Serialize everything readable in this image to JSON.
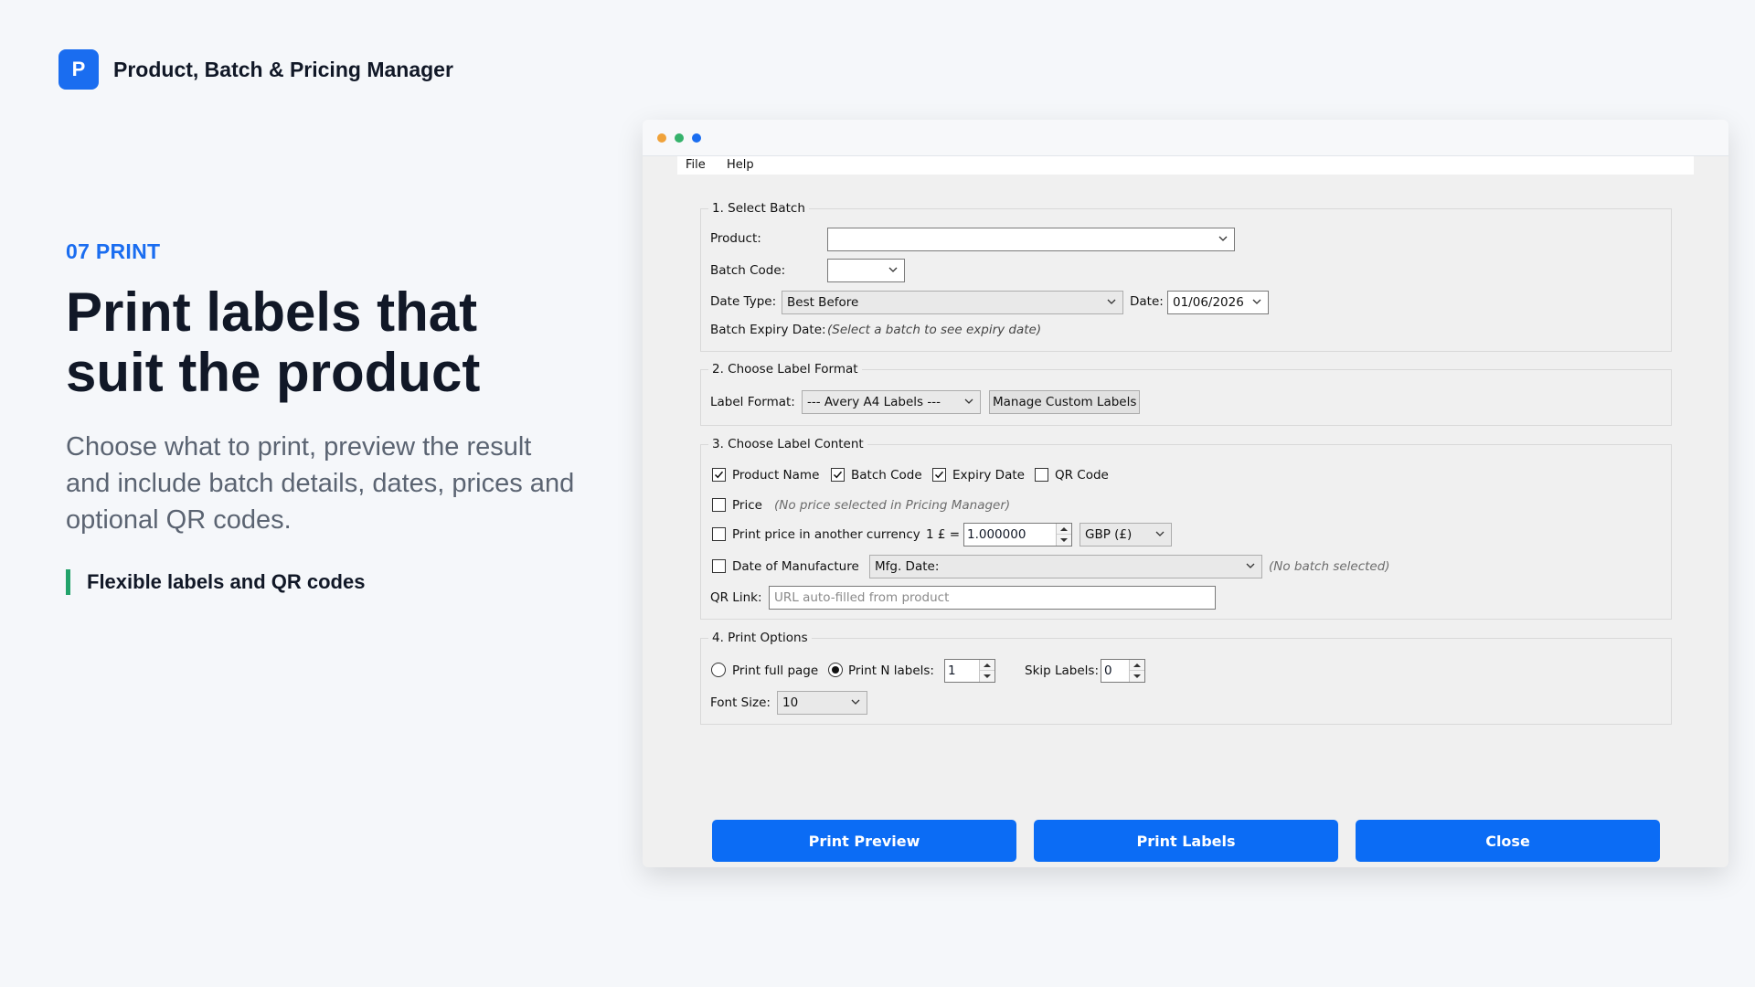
{
  "brand": {
    "badge": "P",
    "name": "Product, Batch & Pricing Manager",
    "color": "#1a6df0"
  },
  "hero": {
    "kicker": "07 PRINT",
    "headline": "Print labels that suit the product",
    "subtext": "Choose what to print, preview the result and include batch details, dates, prices and optional QR codes.",
    "feature": "Flexible labels and QR codes"
  },
  "window": {
    "traffic_colors": [
      "#f0a23a",
      "#35b26b",
      "#1a6df0"
    ],
    "menu": [
      "File",
      "Help"
    ],
    "select_batch": {
      "title": "1. Select Batch",
      "product_label": "Product:",
      "product_value": "",
      "batch_code_label": "Batch Code:",
      "batch_code_value": "",
      "date_type_label": "Date Type:",
      "date_type_value": "Best Before",
      "date_label": "Date:",
      "date_value": "01/06/2026",
      "expiry_label": "Batch Expiry Date:",
      "expiry_value": "(Select a batch to see expiry date)"
    },
    "label_format": {
      "title": "2. Choose Label Format",
      "label": "Label Format:",
      "value": "--- Avery A4 Labels ---",
      "manage_button": "Manage Custom Labels"
    },
    "label_content": {
      "title": "3. Choose Label Content",
      "product_name": {
        "label": "Product Name",
        "checked": true
      },
      "batch_code": {
        "label": "Batch Code",
        "checked": true
      },
      "expiry_date": {
        "label": "Expiry Date",
        "checked": true
      },
      "qr_code": {
        "label": "QR Code",
        "checked": false
      },
      "price": {
        "label": "Price",
        "checked": false,
        "note": "(No price selected in Pricing Manager)"
      },
      "currency": {
        "label": "Print price in another currency",
        "checked": false,
        "rate_label": "1 £ =",
        "rate_value": "1.000000",
        "currency_value": "GBP (£)"
      },
      "manufacture": {
        "label": "Date of Manufacture",
        "checked": false,
        "value": "Mfg. Date:",
        "note": "(No batch selected)"
      },
      "qr_link_label": "QR Link:",
      "qr_link_placeholder": "URL auto-filled from product"
    },
    "print_options": {
      "title": "4. Print Options",
      "full_page_label": "Print full page",
      "full_page_selected": false,
      "n_labels_label": "Print N labels:",
      "n_labels_selected": true,
      "n_labels_value": "1",
      "skip_label": "Skip Labels:",
      "skip_value": "0",
      "font_size_label": "Font Size:",
      "font_size_value": "10"
    },
    "buttons": {
      "preview": "Print Preview",
      "print": "Print Labels",
      "close": "Close",
      "color": "#0b6cf5"
    }
  }
}
